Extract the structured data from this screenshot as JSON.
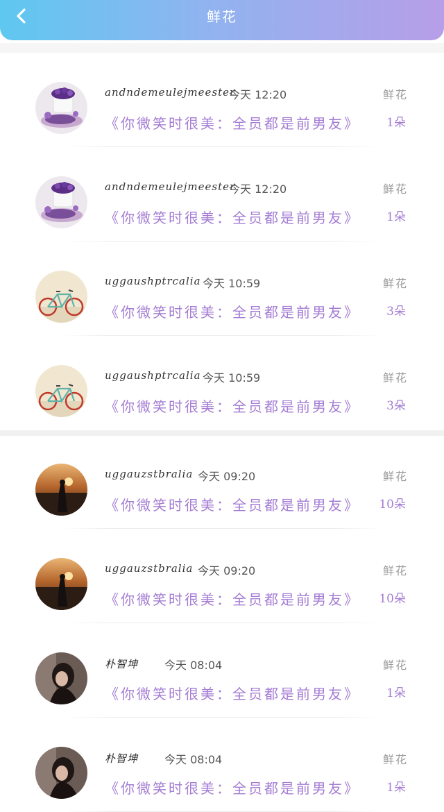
{
  "header": {
    "title": "鲜花",
    "back_icon": "chevron-left-icon",
    "gradient": [
      "#5ec8f0",
      "#b79ee8"
    ]
  },
  "accent_color": "#a47dd3",
  "records": [
    {
      "avatar": "flower-pot-avatar",
      "name": "andndemeulejmeester",
      "time": "今天 12:20",
      "message": "《你微笑时很美：全员都是前男友》",
      "gift": "鲜花",
      "count": "1朵"
    },
    {
      "avatar": "flower-pot-avatar",
      "name": "andndemeulejmeester",
      "time": "今天 12:20",
      "message": "《你微笑时很美：全员都是前男友》",
      "gift": "鲜花",
      "count": "1朵"
    },
    {
      "avatar": "bicycle-avatar",
      "name": "uggaushptrcalia",
      "time": "今天 10:59",
      "message": "《你微笑时很美：全员都是前男友》",
      "gift": "鲜花",
      "count": "3朵"
    },
    {
      "avatar": "bicycle-avatar",
      "name": "uggaushptrcalia",
      "time": "今天 10:59",
      "message": "《你微笑时很美：全员都是前男友》",
      "gift": "鲜花",
      "count": "3朵"
    },
    {
      "avatar": "sunset-avatar",
      "name": "uggauzstbralia",
      "time": "今天 09:20",
      "message": "《你微笑时很美：全员都是前男友》",
      "gift": "鲜花",
      "count": "10朵"
    },
    {
      "avatar": "sunset-avatar",
      "name": "uggauzstbralia",
      "time": "今天 09:20",
      "message": "《你微笑时很美：全员都是前男友》",
      "gift": "鲜花",
      "count": "10朵"
    },
    {
      "avatar": "portrait-avatar",
      "name": "朴智坤",
      "time": "今天 08:04",
      "message": "《你微笑时很美：全员都是前男友》",
      "gift": "鲜花",
      "count": "1朵"
    },
    {
      "avatar": "portrait-avatar",
      "name": "朴智坤",
      "time": "今天 08:04",
      "message": "《你微笑时很美：全员都是前男友》",
      "gift": "鲜花",
      "count": "1朵"
    }
  ]
}
